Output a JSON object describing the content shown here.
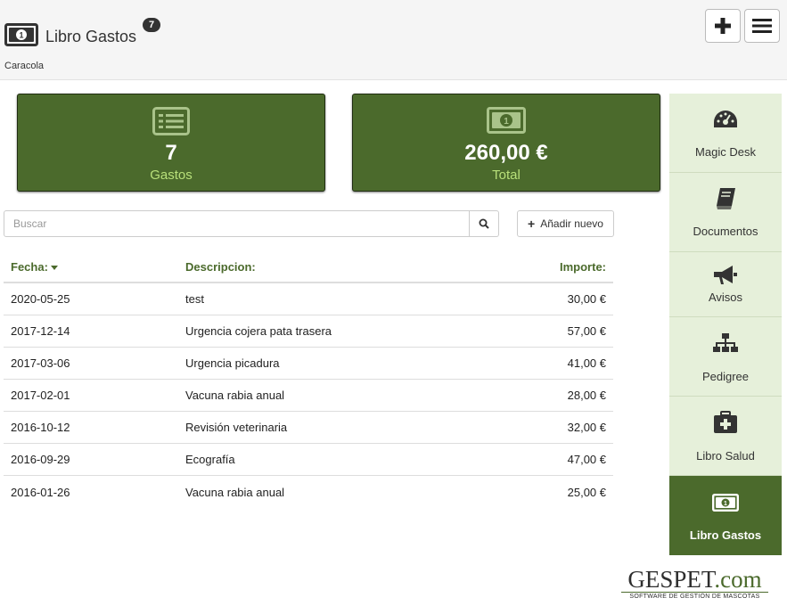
{
  "header": {
    "title": "Libro Gastos",
    "badge": "7",
    "subtitle": "Caracola",
    "icon": "money-icon",
    "add_icon": "plus-icon",
    "menu_icon": "hamburger-icon"
  },
  "summary": {
    "count_value": "7",
    "count_label": "Gastos",
    "count_icon": "list-icon",
    "total_value": "260,00 €",
    "total_label": "Total",
    "total_icon": "money-icon"
  },
  "search": {
    "placeholder": "Buscar",
    "value": "",
    "icon": "search-icon"
  },
  "add_button": {
    "label": "Añadir nuevo",
    "icon": "plus-icon"
  },
  "table": {
    "columns": {
      "date": "Fecha:",
      "description": "Descripcion:",
      "amount": "Importe:"
    },
    "sort": {
      "column": "date",
      "direction": "desc"
    },
    "rows": [
      {
        "date": "2020-05-25",
        "description": "test",
        "amount": "30,00 €"
      },
      {
        "date": "2017-12-14",
        "description": "Urgencia cojera pata trasera",
        "amount": "57,00 €"
      },
      {
        "date": "2017-03-06",
        "description": "Urgencia picadura",
        "amount": "41,00 €"
      },
      {
        "date": "2017-02-01",
        "description": "Vacuna rabia anual",
        "amount": "28,00 €"
      },
      {
        "date": "2016-10-12",
        "description": "Revisión veterinaria",
        "amount": "32,00 €"
      },
      {
        "date": "2016-09-29",
        "description": "Ecografía",
        "amount": "47,00 €"
      },
      {
        "date": "2016-01-26",
        "description": "Vacuna rabia anual",
        "amount": "25,00 €"
      }
    ]
  },
  "sidebar": {
    "items": [
      {
        "label": "Magic Desk",
        "icon": "dashboard-icon"
      },
      {
        "label": "Documentos",
        "icon": "book-icon"
      },
      {
        "label": "Avisos",
        "icon": "megaphone-icon"
      },
      {
        "label": "Pedigree",
        "icon": "sitemap-icon"
      },
      {
        "label": "Libro Salud",
        "icon": "medkit-icon"
      },
      {
        "label": "Libro Gastos",
        "icon": "money-icon"
      }
    ],
    "active": "Libro Gastos"
  },
  "logo": {
    "main": "GESPET",
    "suffix": ".com",
    "tagline": "SOFTWARE DE GESTIÓN DE MASCOTAS"
  },
  "colors": {
    "accent": "#4b6a2c",
    "accent_light": "#b8e07a",
    "sidebar_bg": "#e6f0da",
    "header_bg": "#f5f5f5"
  }
}
